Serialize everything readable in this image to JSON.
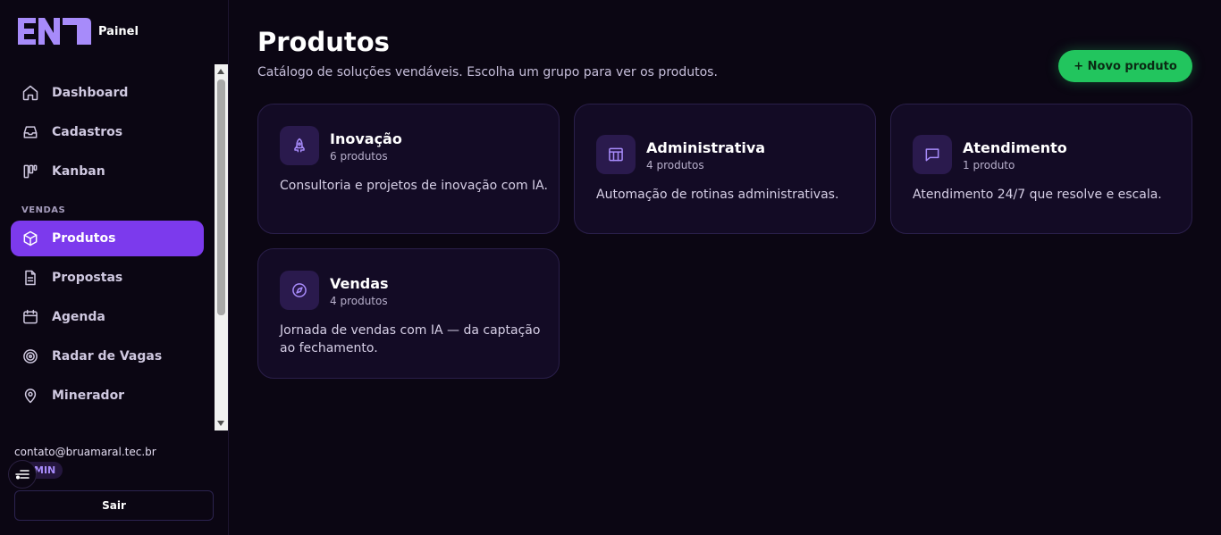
{
  "brand": {
    "logo_text": "ENT",
    "subtitle": "Painel"
  },
  "sidebar": {
    "items": [
      {
        "label": "Dashboard",
        "icon": "home-icon"
      },
      {
        "label": "Cadastros",
        "icon": "inbox-icon"
      },
      {
        "label": "Kanban",
        "icon": "kanban-icon"
      }
    ],
    "section_vendas": "VENDAS",
    "sales_items": [
      {
        "label": "Produtos",
        "icon": "box-icon",
        "active": true
      },
      {
        "label": "Propostas",
        "icon": "document-icon"
      },
      {
        "label": "Agenda",
        "icon": "calendar-icon"
      },
      {
        "label": "Radar de Vagas",
        "icon": "target-icon"
      },
      {
        "label": "Minerador",
        "icon": "map-pin-icon"
      }
    ]
  },
  "user": {
    "email": "contato@bruamaral.tec.br",
    "role": "MIN"
  },
  "logout_label": "Sair",
  "page": {
    "title": "Produtos",
    "subtitle": "Catálogo de soluções vendáveis. Escolha um grupo para ver os produtos.",
    "new_button": "+ Novo produto"
  },
  "groups": [
    {
      "title": "Inovação",
      "count": "6 produtos",
      "description": "Consultoria e projetos de inovação com IA.",
      "icon": "rocket-icon"
    },
    {
      "title": "Administrativa",
      "count": "4 produtos",
      "description": "Automação de rotinas administrativas.",
      "icon": "table-icon"
    },
    {
      "title": "Atendimento",
      "count": "1 produto",
      "description": "Atendimento 24/7 que resolve e escala.",
      "icon": "chat-icon"
    },
    {
      "title": "Vendas",
      "count": "4 produtos",
      "description": "Jornada de vendas com IA — da captação ao fechamento.",
      "icon": "compass-icon"
    }
  ],
  "colors": {
    "accent": "#7c3aed",
    "success": "#22c55e",
    "background": "#0b0613",
    "card": "#130b25"
  }
}
